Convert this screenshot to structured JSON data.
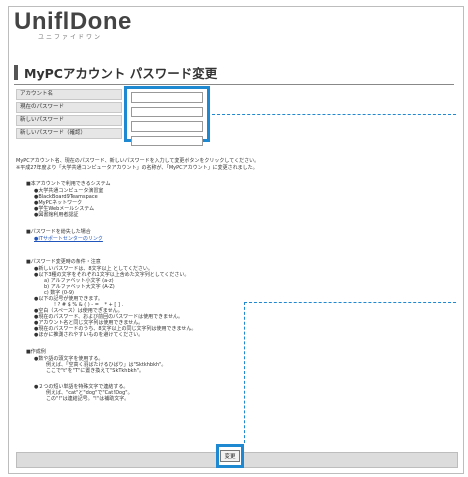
{
  "header": {
    "logo": "UniflDone",
    "logo_sub": "ユニファイドワン"
  },
  "page": {
    "title": "MyPCアカウント パスワード変更"
  },
  "form": {
    "labels": [
      "アカウント名",
      "現在のパスワード",
      "新しいパスワード",
      "新しいパスワード（確認）"
    ],
    "values": [
      "",
      "",
      "",
      ""
    ]
  },
  "instructions": {
    "line1": "MyPCアカウント名、現在のパスワード、新しいパスワードを入力して変更ボタンをクリックしてください。",
    "line2": "※平成27年度より「大学共通コンピュータアカウント」の名称が、「MyPCアカウント」に変更されました。"
  },
  "systems": {
    "heading": "■本アカウントで利用できるシステム",
    "items": [
      "●大学共通コンピュータ演習室",
      "●BlackBoard9Teamspace",
      "●MyPCネットワーク",
      "●学生Webメールシステム",
      "●図書館利用者認証"
    ]
  },
  "forgot": {
    "heading": "■パスワードを紛失した場合",
    "link": "●ITサポートセンターのリンク"
  },
  "conditions": {
    "heading": "■パスワード変更時の条件・注意",
    "items": [
      "●新しいパスワードは、8文字以上 としてください。",
      "●以下3種の文字をそれぞれ1文字以上含めた文字列としてください。",
      "a) アルファベット小文字 (a-z)",
      "b) アルファベット大文字 (A-Z)",
      "c) 数字 (0-9)",
      "●以下の記号が使用できます。",
      "! ? # $ % & ( ) - = _ * + [ ] .",
      "●空白（スペース）は使用できません。",
      "●現在のパスワード、および前回のパスワードは使用できません。",
      "●アカウント名と同じ文字列は使用できません。",
      "●現在のパスワードのうち、8文字以上の同じ文字列は使用できません。",
      "●ほかに推測されやすいものを避けてください。"
    ]
  },
  "example": {
    "heading": "■作成例",
    "items": [
      "●数や語の頭文字を使用する。",
      "例えば、「空高く羽ばたけるひばり」は\"Sktkhbkh\"。",
      "ここで\"t\"を\"T\"に置き換えて\"SkTkhbkh\"。",
      "●２つの短い単語を特殊文字で連結する。",
      "例えば、\"cat\"と\"dog\"で\"Cat!Dog\"。",
      "この\"!\"は連結記号。\"!\"は補助文字。"
    ]
  },
  "footer": {
    "submit_label": "変更"
  },
  "colors": {
    "highlight": "#1e88d0"
  }
}
